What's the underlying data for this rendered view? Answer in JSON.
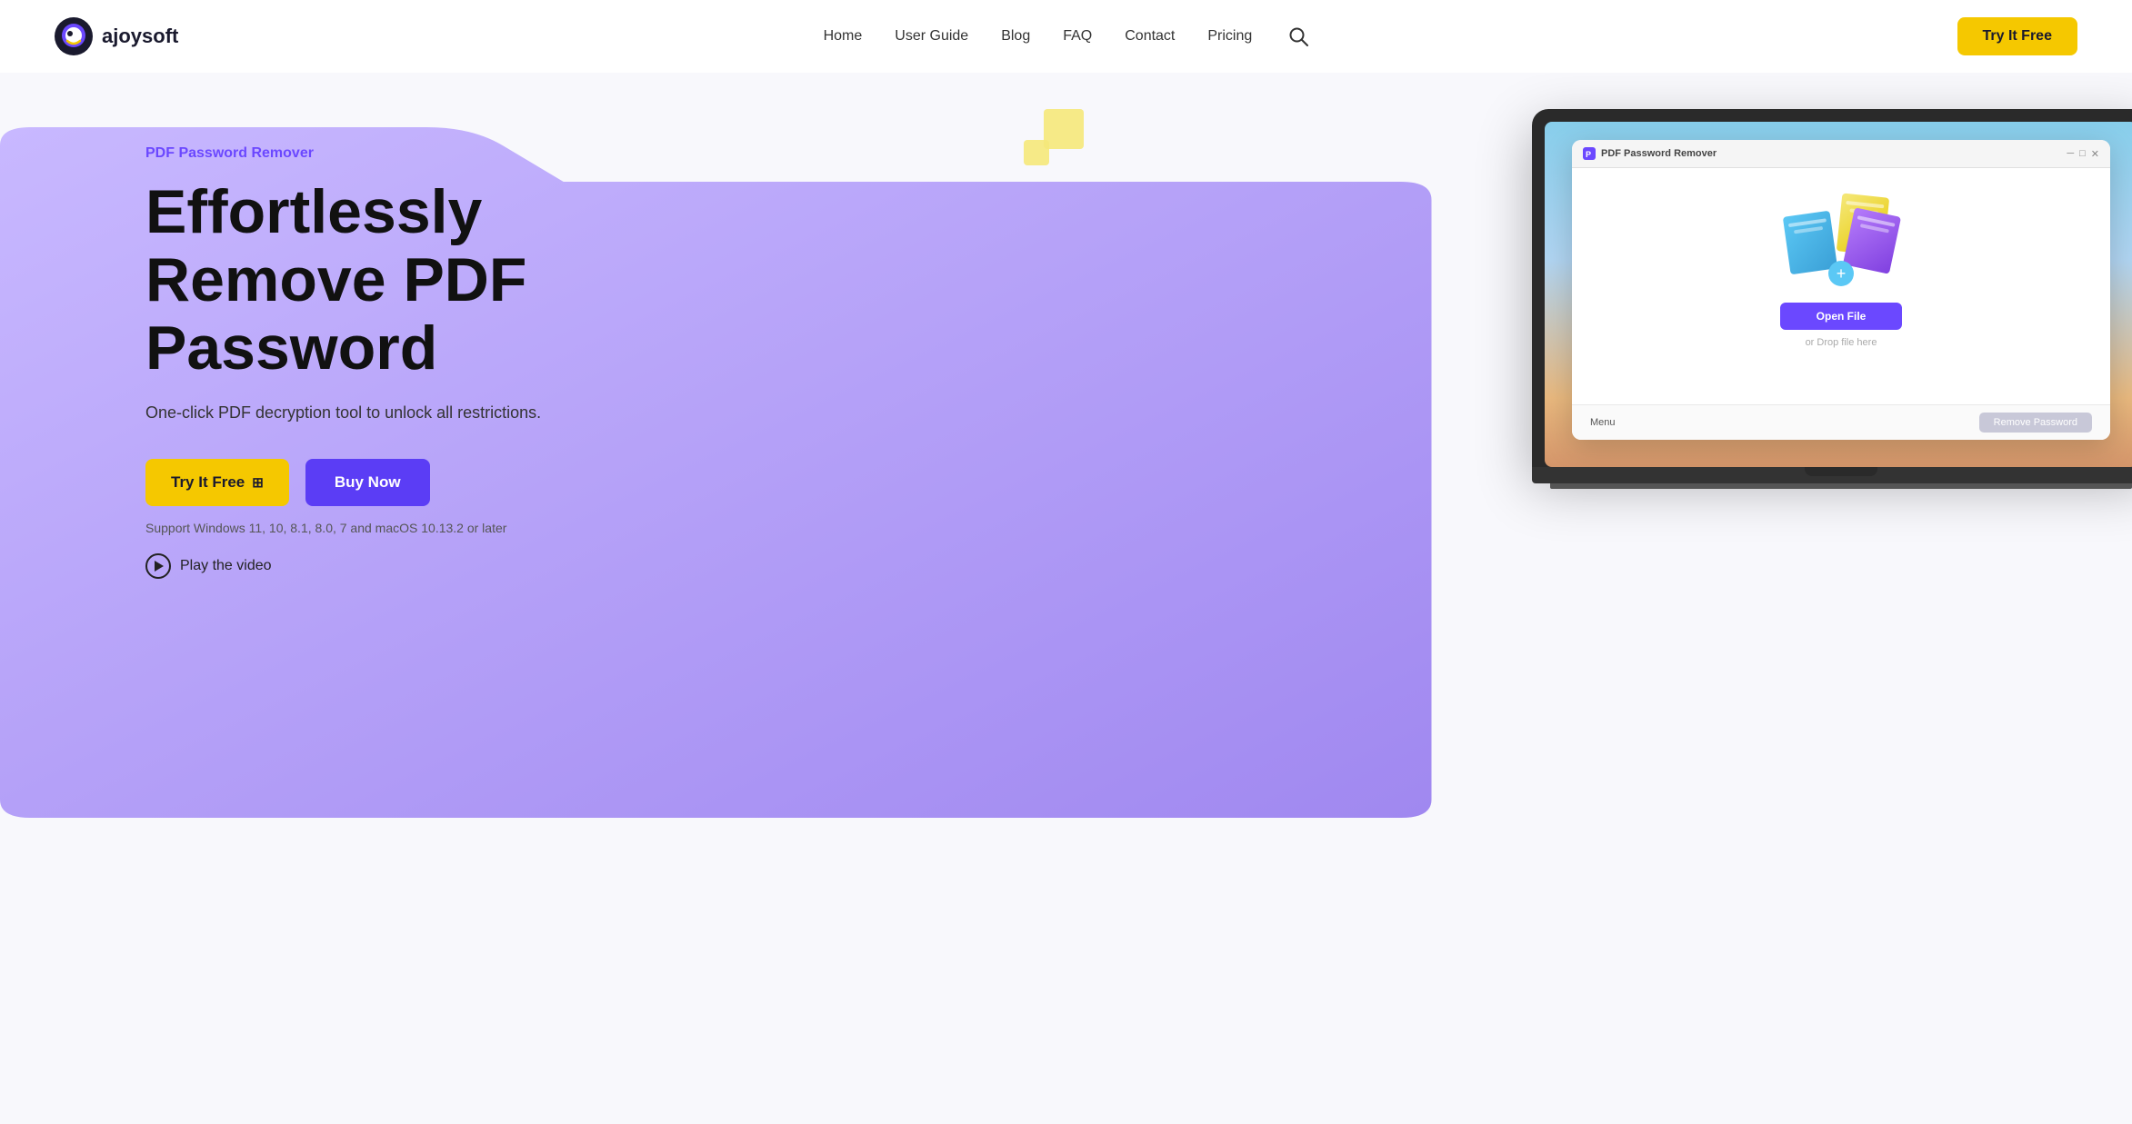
{
  "header": {
    "logo_text": "ajoysoft",
    "nav_items": [
      {
        "label": "Home",
        "id": "home"
      },
      {
        "label": "User Guide",
        "id": "user-guide"
      },
      {
        "label": "Blog",
        "id": "blog"
      },
      {
        "label": "FAQ",
        "id": "faq"
      },
      {
        "label": "Contact",
        "id": "contact"
      },
      {
        "label": "Pricing",
        "id": "pricing"
      }
    ],
    "cta_label": "Try It Free"
  },
  "hero": {
    "product_label": "PDF Password Remover",
    "title_line1": "Effortlessly",
    "title_line2": "Remove PDF",
    "title_line3": "Password",
    "subtitle": "One-click PDF decryption tool to unlock all restrictions.",
    "btn_try": "Try It Free",
    "btn_buy": "Buy Now",
    "support_text": "Support Windows 11, 10, 8.1, 8.0, 7 and macOS 10.13.2 or later",
    "play_label": "Play the video"
  },
  "app_window": {
    "title": "PDF Password Remover",
    "open_file_btn": "Open File",
    "drop_text": "or Drop file here",
    "menu_label": "Menu",
    "remove_btn": "Remove Password"
  },
  "icons": {
    "search": "🔍",
    "play": "▶",
    "windows": "⊞"
  }
}
